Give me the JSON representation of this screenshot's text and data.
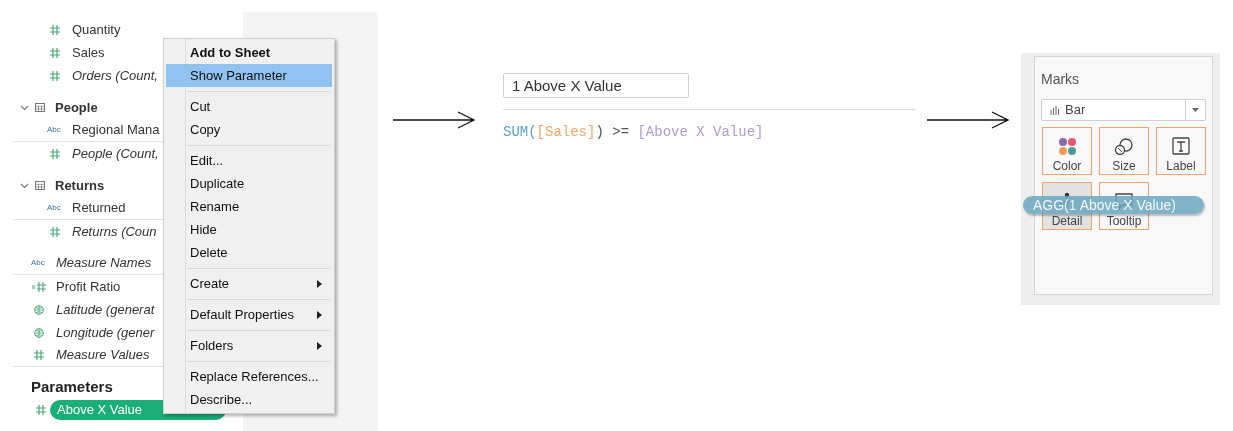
{
  "data_pane": {
    "table_fields": [
      {
        "kind": "measure",
        "label": "Quantity",
        "italic": false
      },
      {
        "kind": "measure",
        "label": "Sales",
        "italic": false
      },
      {
        "kind": "measure",
        "label": "Orders (Count,",
        "italic": true
      }
    ],
    "tables": [
      {
        "label": "People",
        "expanded": true,
        "children": [
          {
            "kind": "dimension",
            "icon_text": "Abc",
            "label": "Regional Mana",
            "italic": false
          },
          {
            "kind": "measure",
            "label": "People (Count,",
            "italic": true
          }
        ]
      },
      {
        "label": "Returns",
        "expanded": true,
        "children": [
          {
            "kind": "dimension",
            "icon_text": "Abc",
            "label": "Returned",
            "italic": false
          },
          {
            "kind": "measure",
            "label": "Returns (Coun",
            "italic": true
          }
        ]
      }
    ],
    "other_fields": [
      {
        "kind": "dimension",
        "icon_text": "Abc",
        "label": "Measure Names",
        "italic": true
      },
      {
        "kind": "calc",
        "label": "Profit Ratio",
        "italic": false
      },
      {
        "kind": "geo",
        "label": "Latitude (generat",
        "italic": true
      },
      {
        "kind": "geo",
        "label": "Longitude (gener",
        "italic": true
      },
      {
        "kind": "measure",
        "label": "Measure Values",
        "italic": true
      }
    ],
    "parameters": {
      "title": "Parameters",
      "items": [
        {
          "label": "Above X Value",
          "selected": true
        }
      ]
    }
  },
  "context_menu": [
    {
      "kind": "item",
      "label": "Add to Sheet",
      "bold": true,
      "selected": false
    },
    {
      "kind": "item",
      "label": "Show Parameter",
      "selected": true
    },
    {
      "kind": "separator"
    },
    {
      "kind": "item",
      "label": "Cut",
      "selected": false
    },
    {
      "kind": "item",
      "label": "Copy",
      "selected": false
    },
    {
      "kind": "separator"
    },
    {
      "kind": "item",
      "label": "Edit...",
      "selected": false
    },
    {
      "kind": "item",
      "label": "Duplicate",
      "selected": false
    },
    {
      "kind": "item",
      "label": "Rename",
      "selected": false
    },
    {
      "kind": "item",
      "label": "Hide",
      "selected": false
    },
    {
      "kind": "item",
      "label": "Delete",
      "selected": false
    },
    {
      "kind": "separator"
    },
    {
      "kind": "item",
      "label": "Create",
      "submenu": true,
      "selected": false
    },
    {
      "kind": "separator"
    },
    {
      "kind": "item",
      "label": "Default Properties",
      "submenu": true,
      "selected": false
    },
    {
      "kind": "separator"
    },
    {
      "kind": "item",
      "label": "Folders",
      "submenu": true,
      "selected": false
    },
    {
      "kind": "separator"
    },
    {
      "kind": "item",
      "label": "Replace References...",
      "selected": false
    },
    {
      "kind": "item",
      "label": "Describe...",
      "selected": false
    }
  ],
  "calculation": {
    "name": "1 Above X Value",
    "formula": [
      {
        "kind": "function",
        "text": "SUM("
      },
      {
        "kind": "field",
        "text": "[Sales]"
      },
      {
        "kind": "operator",
        "text": ") >= "
      },
      {
        "kind": "parameter",
        "text": "[Above X Value]"
      }
    ]
  },
  "marks": {
    "title": "Marks",
    "mark_type": "Bar",
    "cards": [
      {
        "kind": "color",
        "label": "Color",
        "selected": false
      },
      {
        "kind": "size",
        "label": "Size",
        "selected": false
      },
      {
        "kind": "label",
        "label": "Label",
        "selected": false
      },
      {
        "kind": "detail",
        "label": "Detail",
        "selected": true
      },
      {
        "kind": "tooltip",
        "label": "Tooltip",
        "selected": false
      }
    ],
    "drag_pill": "AGG(1 Above X Value)"
  }
}
